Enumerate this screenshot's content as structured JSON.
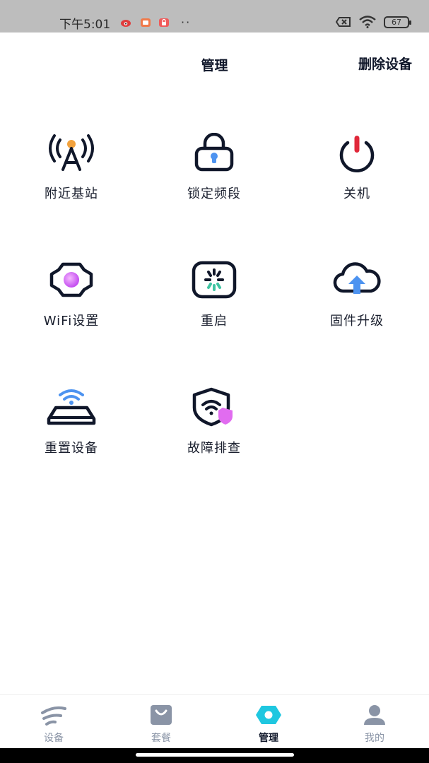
{
  "status": {
    "time": "下午5:01",
    "battery": "67"
  },
  "header": {
    "title": "管理",
    "action": "删除设备"
  },
  "tiles": [
    {
      "label": "附近基站",
      "icon": "antenna-tower-icon"
    },
    {
      "label": "锁定频段",
      "icon": "lock-icon"
    },
    {
      "label": "关机",
      "icon": "power-icon"
    },
    {
      "label": "WiFi设置",
      "icon": "gear-icon"
    },
    {
      "label": "重启",
      "icon": "restart-icon"
    },
    {
      "label": "固件升级",
      "icon": "cloud-upload-icon"
    },
    {
      "label": "重置设备",
      "icon": "router-reset-icon"
    },
    {
      "label": "故障排查",
      "icon": "shield-wifi-icon"
    }
  ],
  "tabs": [
    {
      "label": "设备",
      "icon": "device-icon",
      "active": false
    },
    {
      "label": "套餐",
      "icon": "package-bag-icon",
      "active": false
    },
    {
      "label": "管理",
      "icon": "manage-hex-icon",
      "active": true
    },
    {
      "label": "我的",
      "icon": "profile-icon",
      "active": false
    }
  ],
  "colors": {
    "primary_text": "#10172a",
    "accent_cyan": "#1fc7e0",
    "accent_blue": "#3d8bf2",
    "accent_pink": "#e16cf0",
    "power_red": "#e0283a",
    "tab_inactive": "#8a94a6"
  }
}
